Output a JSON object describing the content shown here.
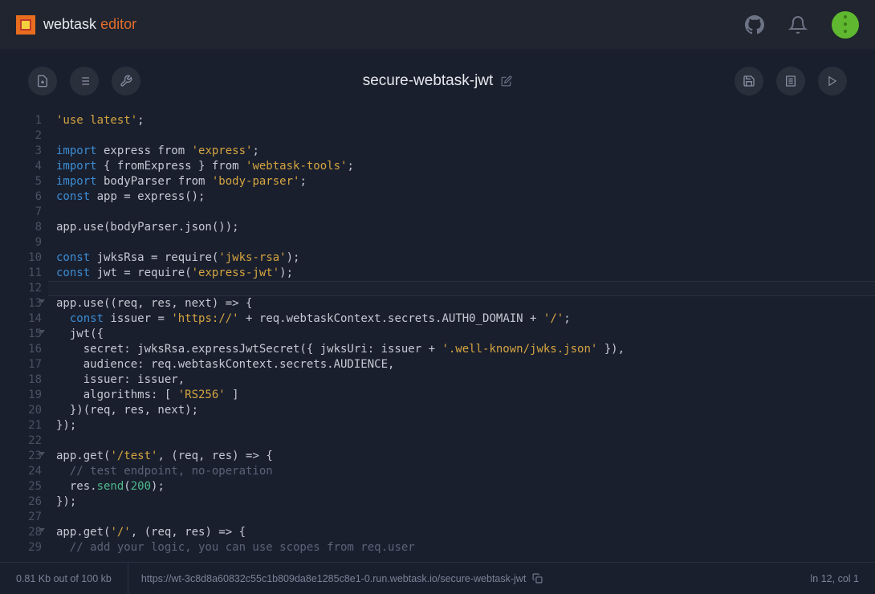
{
  "brand": {
    "name": "webtask",
    "accent": "editor"
  },
  "title": "secure-webtask-jwt",
  "status": {
    "size": "0.81 Kb out of 100 kb",
    "url": "https://wt-3c8d8a60832c55c1b809da8e1285c8e1-0.run.webtask.io/secure-webtask-jwt",
    "cursor": "ln 12, col 1"
  },
  "code": [
    {
      "n": 1,
      "t": [
        {
          "c": "str",
          "v": "'use latest'"
        },
        {
          "c": "",
          "v": ";"
        }
      ]
    },
    {
      "n": 2,
      "t": []
    },
    {
      "n": 3,
      "t": [
        {
          "c": "kw",
          "v": "import"
        },
        {
          "c": "",
          "v": " express from "
        },
        {
          "c": "str",
          "v": "'express'"
        },
        {
          "c": "",
          "v": ";"
        }
      ]
    },
    {
      "n": 4,
      "t": [
        {
          "c": "kw",
          "v": "import"
        },
        {
          "c": "",
          "v": " { fromExpress } from "
        },
        {
          "c": "str",
          "v": "'webtask-tools'"
        },
        {
          "c": "",
          "v": ";"
        }
      ]
    },
    {
      "n": 5,
      "t": [
        {
          "c": "kw",
          "v": "import"
        },
        {
          "c": "",
          "v": " bodyParser from "
        },
        {
          "c": "str",
          "v": "'body-parser'"
        },
        {
          "c": "",
          "v": ";"
        }
      ]
    },
    {
      "n": 6,
      "t": [
        {
          "c": "kw",
          "v": "const"
        },
        {
          "c": "",
          "v": " app = express();"
        }
      ]
    },
    {
      "n": 7,
      "t": []
    },
    {
      "n": 8,
      "t": [
        {
          "c": "",
          "v": "app.use(bodyParser.json());"
        }
      ]
    },
    {
      "n": 9,
      "t": []
    },
    {
      "n": 10,
      "t": [
        {
          "c": "kw",
          "v": "const"
        },
        {
          "c": "",
          "v": " jwksRsa = require("
        },
        {
          "c": "str",
          "v": "'jwks-rsa'"
        },
        {
          "c": "",
          "v": ");"
        }
      ]
    },
    {
      "n": 11,
      "t": [
        {
          "c": "kw",
          "v": "const"
        },
        {
          "c": "",
          "v": " jwt = require("
        },
        {
          "c": "str",
          "v": "'express-jwt'"
        },
        {
          "c": "",
          "v": ");"
        }
      ]
    },
    {
      "n": 12,
      "active": true,
      "t": []
    },
    {
      "n": 13,
      "fold": true,
      "t": [
        {
          "c": "",
          "v": "app.use((req, res, next) => {"
        }
      ]
    },
    {
      "n": 14,
      "t": [
        {
          "c": "",
          "v": "  "
        },
        {
          "c": "kw",
          "v": "const"
        },
        {
          "c": "",
          "v": " issuer = "
        },
        {
          "c": "str",
          "v": "'https://'"
        },
        {
          "c": "",
          "v": " + req.webtaskContext.secrets.AUTH0_DOMAIN + "
        },
        {
          "c": "str",
          "v": "'/'"
        },
        {
          "c": "",
          "v": ";"
        }
      ]
    },
    {
      "n": 15,
      "fold": true,
      "t": [
        {
          "c": "",
          "v": "  jwt({"
        }
      ]
    },
    {
      "n": 16,
      "t": [
        {
          "c": "",
          "v": "    secret: jwksRsa.expressJwtSecret({ jwksUri: issuer + "
        },
        {
          "c": "str",
          "v": "'.well-known/jwks.json'"
        },
        {
          "c": "",
          "v": " }),"
        }
      ]
    },
    {
      "n": 17,
      "t": [
        {
          "c": "",
          "v": "    audience: req.webtaskContext.secrets.AUDIENCE,"
        }
      ]
    },
    {
      "n": 18,
      "t": [
        {
          "c": "",
          "v": "    issuer: issuer,"
        }
      ]
    },
    {
      "n": 19,
      "t": [
        {
          "c": "",
          "v": "    algorithms: [ "
        },
        {
          "c": "str",
          "v": "'RS256'"
        },
        {
          "c": "",
          "v": " ]"
        }
      ]
    },
    {
      "n": 20,
      "t": [
        {
          "c": "",
          "v": "  })(req, res, next);"
        }
      ]
    },
    {
      "n": 21,
      "t": [
        {
          "c": "",
          "v": "});"
        }
      ]
    },
    {
      "n": 22,
      "t": []
    },
    {
      "n": 23,
      "fold": true,
      "t": [
        {
          "c": "",
          "v": "app.get("
        },
        {
          "c": "str",
          "v": "'/test'"
        },
        {
          "c": "",
          "v": ", (req, res) => {"
        }
      ]
    },
    {
      "n": 24,
      "t": [
        {
          "c": "",
          "v": "  "
        },
        {
          "c": "cm",
          "v": "// test endpoint, no-operation"
        }
      ]
    },
    {
      "n": 25,
      "t": [
        {
          "c": "",
          "v": "  res."
        },
        {
          "c": "fn",
          "v": "send"
        },
        {
          "c": "",
          "v": "("
        },
        {
          "c": "num",
          "v": "200"
        },
        {
          "c": "",
          "v": ");"
        }
      ]
    },
    {
      "n": 26,
      "t": [
        {
          "c": "",
          "v": "});"
        }
      ]
    },
    {
      "n": 27,
      "t": []
    },
    {
      "n": 28,
      "fold": true,
      "t": [
        {
          "c": "",
          "v": "app.get("
        },
        {
          "c": "str",
          "v": "'/'"
        },
        {
          "c": "",
          "v": ", (req, res) => {"
        }
      ]
    },
    {
      "n": 29,
      "t": [
        {
          "c": "",
          "v": "  "
        },
        {
          "c": "cm",
          "v": "// add your logic, you can use scopes from req.user"
        }
      ]
    }
  ]
}
